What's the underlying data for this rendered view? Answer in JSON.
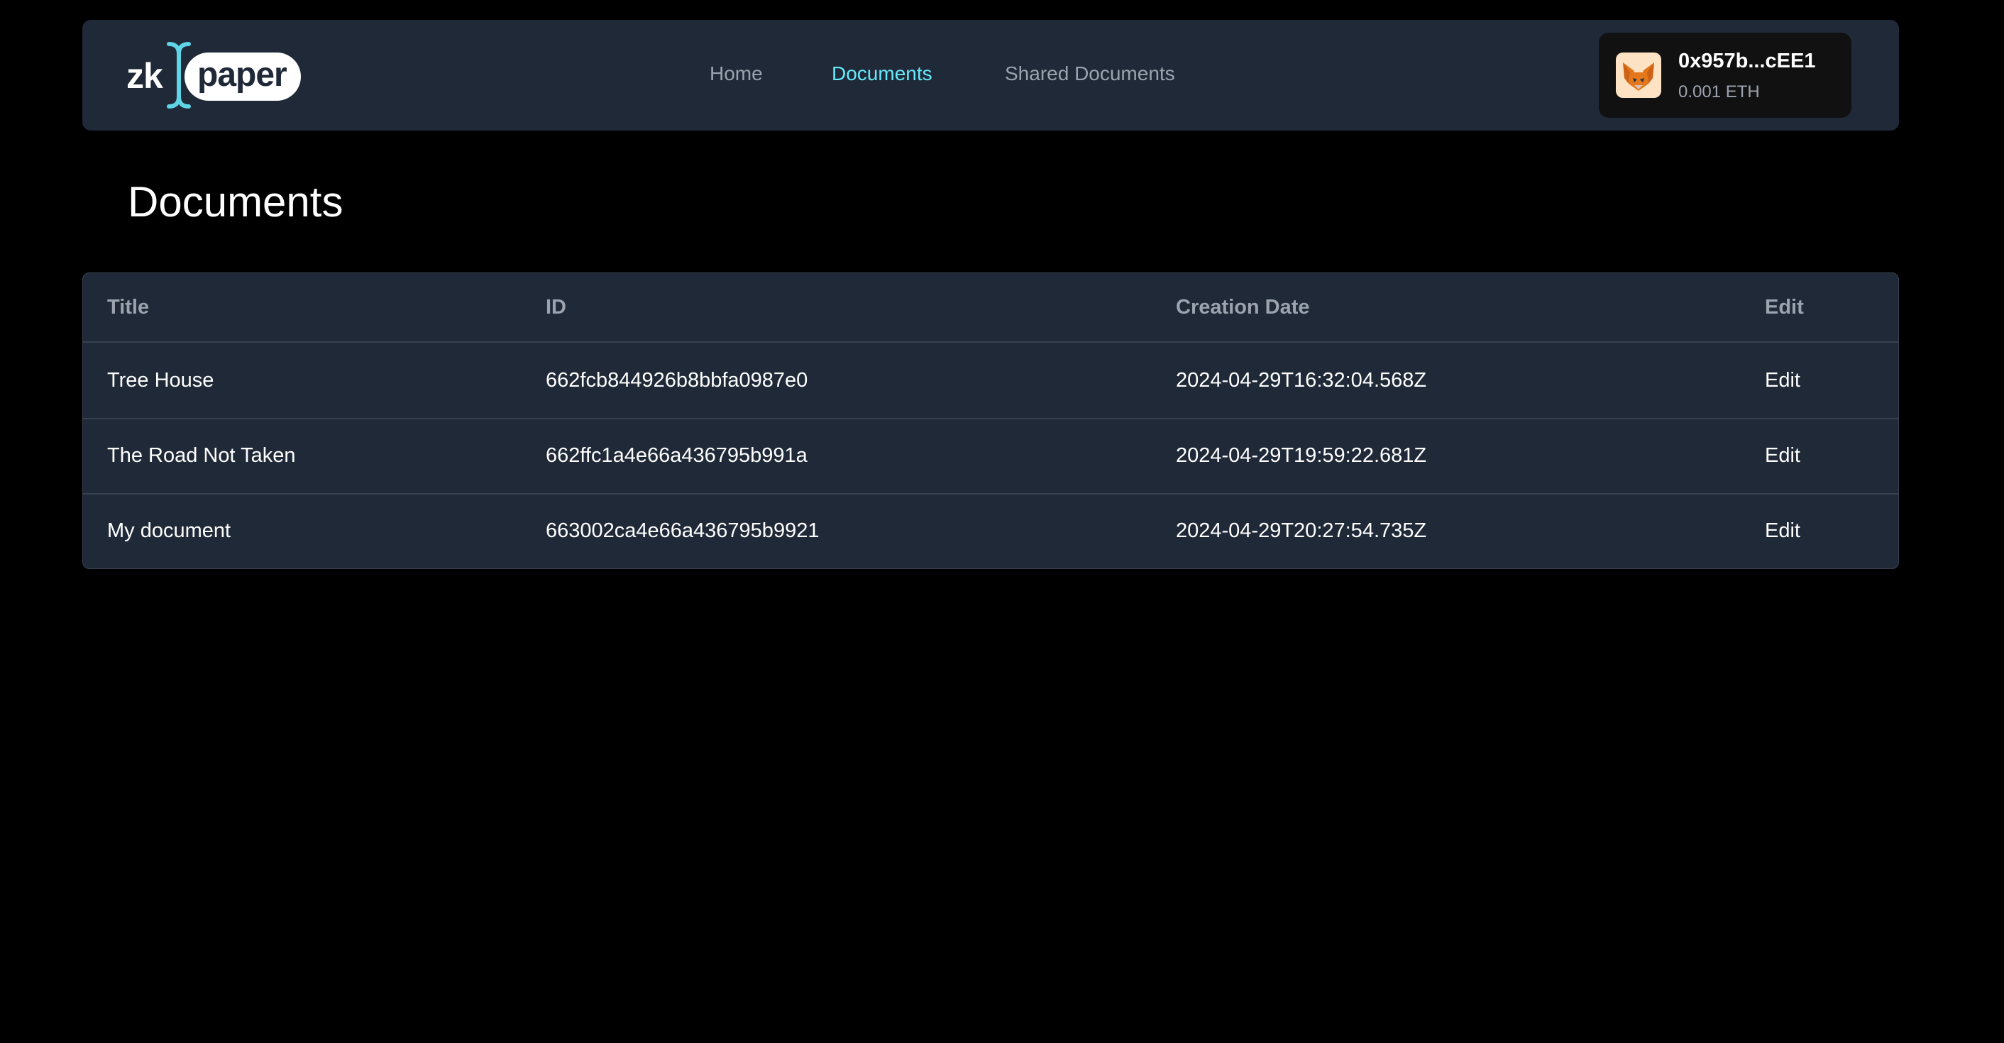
{
  "logo": {
    "prefix": "zk",
    "word": "paper"
  },
  "nav": {
    "links": [
      {
        "label": "Home"
      },
      {
        "label": "Documents"
      },
      {
        "label": "Shared Documents"
      }
    ],
    "active_index": 1
  },
  "wallet": {
    "address": "0x957b...cEE1",
    "balance": "0.001 ETH",
    "avatar_icon": "metamask-fox-icon"
  },
  "page": {
    "title": "Documents"
  },
  "table": {
    "headers": {
      "title": "Title",
      "id": "ID",
      "date": "Creation Date",
      "edit": "Edit"
    },
    "rows": [
      {
        "title": "Tree House",
        "id": "662fcb844926b8bbfa0987e0",
        "date": "2024-04-29T16:32:04.568Z",
        "edit": "Edit"
      },
      {
        "title": "The Road Not Taken",
        "id": "662ffc1a4e66a436795b991a",
        "date": "2024-04-29T19:59:22.681Z",
        "edit": "Edit"
      },
      {
        "title": "My document",
        "id": "663002ca4e66a436795b9921",
        "date": "2024-04-29T20:27:54.735Z",
        "edit": "Edit"
      }
    ]
  },
  "colors": {
    "background": "#000000",
    "surface": "#1f2937",
    "accent": "#67e8f9",
    "muted_text": "#9ca3af",
    "divider": "#374151"
  }
}
